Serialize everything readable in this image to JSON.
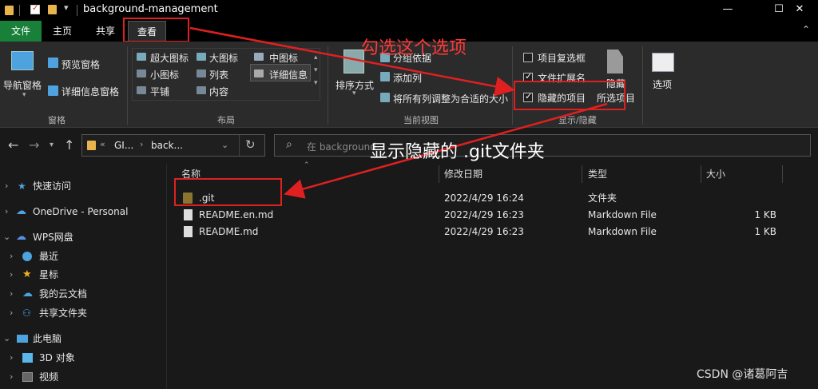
{
  "window": {
    "title": "background-management",
    "minimize": "—",
    "maximize": "☐",
    "close": "✕"
  },
  "tabs": {
    "file": "文件",
    "home": "主页",
    "share": "共享",
    "view": "查看"
  },
  "ribbon": {
    "pane": {
      "nav_pane": "导航窗格",
      "preview_pane": "预览窗格",
      "details_pane": "详细信息窗格",
      "group_label": "窗格"
    },
    "layout": {
      "items": [
        "超大图标",
        "大图标",
        "中图标",
        "小图标",
        "列表",
        "详细信息",
        "平铺",
        "内容"
      ],
      "group_label": "布局"
    },
    "current_view": {
      "sort_by": "排序方式",
      "group_by": "分组依据",
      "add_columns": "添加列",
      "size_all_columns": "将所有列调整为合适的大小",
      "group_label": "当前视图"
    },
    "show_hide": {
      "item_checkboxes": "项目复选框",
      "file_extensions": "文件扩展名",
      "hidden_items": "隐藏的项目",
      "hide_selected_1": "隐藏",
      "hide_selected_2": "所选项目",
      "group_label": "显示/隐藏",
      "item_checkboxes_checked": false,
      "file_extensions_checked": true,
      "hidden_items_checked": true
    },
    "options": {
      "label": "选项"
    }
  },
  "address": {
    "crumb1": "GI...",
    "crumb2": "back...",
    "search_placeholder": "在 background..."
  },
  "nav": {
    "quick_access": "快速访问",
    "onedrive": "OneDrive - Personal",
    "wps": "WPS网盘",
    "recent": "最近",
    "starred": "星标",
    "my_cloud": "我的云文档",
    "shared": "共享文件夹",
    "this_pc": "此电脑",
    "objects_3d": "3D 对象",
    "videos": "视频"
  },
  "columns": {
    "name": "名称",
    "date": "修改日期",
    "type": "类型",
    "size": "大小"
  },
  "files": [
    {
      "name": ".git",
      "date": "2022/4/29 16:24",
      "type": "文件夹",
      "size": ""
    },
    {
      "name": "README.en.md",
      "date": "2022/4/29 16:23",
      "type": "Markdown File",
      "size": "1 KB"
    },
    {
      "name": "README.md",
      "date": "2022/4/29 16:23",
      "type": "Markdown File",
      "size": "1 KB"
    }
  ],
  "annotations": {
    "check_option": "勾选这个选项",
    "show_hidden": "显示隐藏的 .git文件夹"
  },
  "watermark": "CSDN @诸葛阿吉",
  "colors": {
    "annotation_red": "#e02020",
    "file_tab": "#19803a",
    "folder": "#c8a24a"
  }
}
